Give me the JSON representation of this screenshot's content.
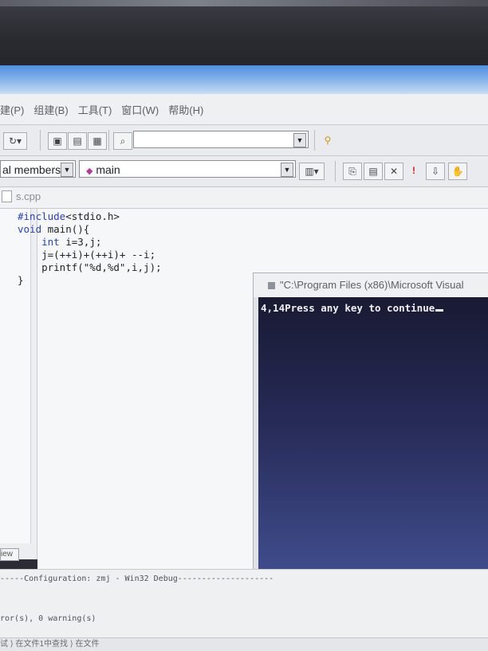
{
  "menu": {
    "items": [
      "建(P)",
      "组建(B)",
      "工具(T)",
      "窗口(W)",
      "帮助(H)"
    ]
  },
  "toolbar": {
    "find_combo_value": "",
    "class_combo_value": "al members",
    "function_combo_value": "main"
  },
  "editor": {
    "tab_label": "s.cpp",
    "code_lines": [
      "#include<stdio.h>",
      "void main(){",
      "    int i=3,j;",
      "    j=(++i)+(++i)+ --i;",
      "    printf(\"%d,%d\",i,j);",
      "}"
    ]
  },
  "console": {
    "title": "\"C:\\Program Files (x86)\\Microsoft Visual",
    "output": "4,14Press any key to continue"
  },
  "left_pane": {
    "view_tab_label": "iew"
  },
  "output_panel": {
    "config_line": "-----Configuration: zmj - Win32 Debug--------------------",
    "result_line": "ror(s), 0 warning(s)"
  },
  "status_bar": {
    "text": "试 ⟩ 在文件1中查找 ⟩ 在文件"
  },
  "colors": {
    "keyword": "#2a3fc4",
    "console_bg": "#262a56",
    "title_bar": "#4f8ee0"
  }
}
